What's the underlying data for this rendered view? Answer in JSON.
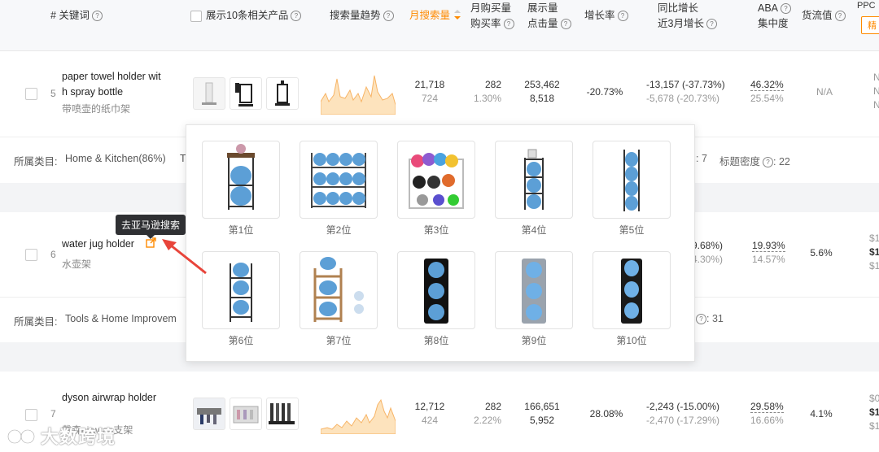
{
  "header": {
    "rank_label": "# 关键词",
    "show_products_label": "展示10条相关产品",
    "trend_label": "搜索量趋势",
    "monthly_search_label": "月搜索量",
    "purchase_label_1": "月购买量",
    "purchase_label_2": "购买率",
    "impressions_label_1": "展示量",
    "impressions_label_2": "点击量",
    "growth_label": "增长率",
    "yoy_label_1": "同比增长",
    "yoy_label_2": "近3月增长",
    "aba_label_1": "ABA",
    "aba_label_2": "集中度",
    "flow_label": "货流值",
    "ppc_label": "PPC",
    "ppc_button": "精"
  },
  "rows": [
    {
      "rank": "5",
      "keyword": "paper towel holder wit\nh spray bottle",
      "keyword_cn": "带喷壶的纸巾架",
      "monthly_search": "21,718",
      "monthly_search_sub": "724",
      "purchase": "282",
      "purchase_rate": "1.30%",
      "impressions": "253,462",
      "clicks": "8,518",
      "growth": "-20.73%",
      "yoy": "-13,157 (-37.73%)",
      "recent3": "-5,678 (-20.73%)",
      "aba": "46.32%",
      "concentration": "25.54%",
      "flow": "N/A",
      "ppc_partial": [
        "N",
        "N",
        "N"
      ]
    },
    {
      "rank": "6",
      "keyword": "water jug holder",
      "keyword_cn": "水壶架",
      "yoy_partial": "9.68%)",
      "recent3_partial": "4.30%)",
      "aba": "19.93%",
      "concentration": "14.57%",
      "flow": "5.6%",
      "ppc_partial": [
        "$1",
        "$1",
        "$1"
      ]
    },
    {
      "rank": "7",
      "keyword": "dyson airwrap holder",
      "keyword_cn": "戴森airwrap支架",
      "monthly_search": "12,712",
      "monthly_search_sub": "424",
      "purchase": "282",
      "purchase_rate": "2.22%",
      "impressions": "166,651",
      "clicks": "5,952",
      "growth": "28.08%",
      "yoy": "-2,243 (-15.00%)",
      "recent3": "-2,470 (-17.29%)",
      "aba": "29.58%",
      "concentration": "16.66%",
      "flow": "4.1%",
      "ppc_partial": [
        "$0",
        "$1",
        "$1"
      ]
    }
  ],
  "category_rows": [
    {
      "label": "所属类目:",
      "value": "Home & Kitchen(86%)",
      "trail": "T",
      "right_partial": ": 7",
      "density_label": "标题密度",
      "density_value": ": 22"
    },
    {
      "label": "所属类目:",
      "value": "Tools & Home Improvem",
      "right_partial": ": 31"
    }
  ],
  "popup": {
    "items": [
      "第1位",
      "第2位",
      "第3位",
      "第4位",
      "第5位",
      "第6位",
      "第7位",
      "第8位",
      "第9位",
      "第10位"
    ]
  },
  "tooltip": "去亚马逊搜索",
  "watermark": "大数跨境",
  "colors": {
    "accent": "#ff8a00",
    "spark_fill": "#fde3bd",
    "spark_line": "#f7b466"
  }
}
